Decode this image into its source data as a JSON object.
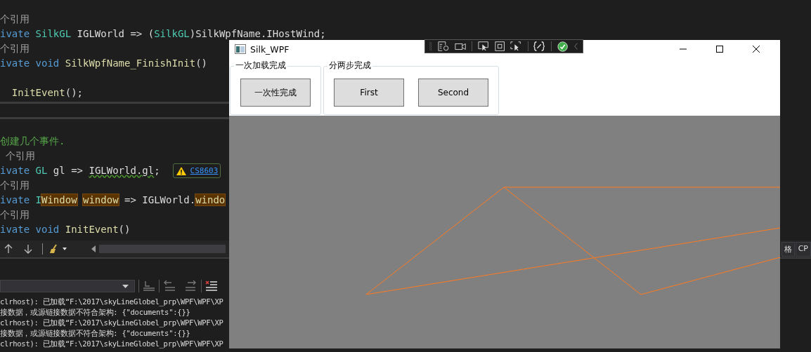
{
  "editor": {
    "top_pane": [
      {
        "kind": "code",
        "segments": [
          {
            "kind": "ref",
            "text": "个引用"
          }
        ]
      },
      {
        "kind": "code",
        "segments": [
          {
            "kind": "kw",
            "text": "ivate "
          },
          {
            "kind": "type",
            "text": "SilkGL"
          },
          {
            "kind": "plain",
            "text": " IGLWorld => ("
          },
          {
            "kind": "type",
            "text": "SilkGL"
          },
          {
            "kind": "plain",
            "text": ")SilkWpfName.IHostWind;"
          }
        ]
      },
      {
        "kind": "code",
        "segments": [
          {
            "kind": "ref",
            "text": "个引用"
          }
        ]
      },
      {
        "kind": "code",
        "segments": [
          {
            "kind": "kw",
            "text": "ivate void "
          },
          {
            "kind": "method",
            "text": "SilkWpfName_FinishInit"
          },
          {
            "kind": "plain",
            "text": "()"
          }
        ]
      },
      {
        "kind": "blank"
      },
      {
        "kind": "code",
        "segments": [
          {
            "kind": "method",
            "text": "  InitEvent"
          },
          {
            "kind": "plain",
            "text": "();"
          }
        ]
      }
    ],
    "bottom_pane": [
      {
        "kind": "blank"
      },
      {
        "kind": "code",
        "segments": [
          {
            "kind": "comment",
            "text": "创建几个事件."
          }
        ]
      },
      {
        "kind": "code",
        "segments": [
          {
            "kind": "ref",
            "text": " 个引用"
          }
        ]
      },
      {
        "kind": "code",
        "badge": "CS8603",
        "segments": [
          {
            "kind": "kw",
            "text": "ivate "
          },
          {
            "kind": "type",
            "text": "GL"
          },
          {
            "kind": "plain",
            "text": " gl => "
          },
          {
            "kind": "warn",
            "text": "IGLWorld.gl"
          },
          {
            "kind": "plain",
            "text": ";"
          }
        ]
      },
      {
        "kind": "code",
        "segments": [
          {
            "kind": "ref",
            "text": "个引用"
          }
        ]
      },
      {
        "kind": "code",
        "segments": [
          {
            "kind": "kw",
            "text": "ivate "
          },
          {
            "kind": "type",
            "text": "I"
          },
          {
            "kind": "hl",
            "text": "Window"
          },
          {
            "kind": "hl",
            "text": "window"
          },
          {
            "kind": "plain",
            "text": " => IGLWorld."
          },
          {
            "kind": "hl",
            "text": "windo"
          }
        ]
      },
      {
        "kind": "code",
        "segments": [
          {
            "kind": "ref",
            "text": "个引用"
          }
        ]
      },
      {
        "kind": "code",
        "segments": [
          {
            "kind": "kw",
            "text": "ivate void "
          },
          {
            "kind": "method",
            "text": "InitEvent"
          },
          {
            "kind": "plain",
            "text": "()"
          }
        ]
      }
    ]
  },
  "side_tabs": [
    "格",
    "CP"
  ],
  "output": {
    "lines": [
      "clrhost): 已加载“F:\\2017\\skyLineGlobel_prp\\WPF\\WPF\\XP",
      "接数据，或源链接数据不符合架构: {\"documents\":{}}",
      "clrhost): 已加载“F:\\2017\\skyLineGlobel_prp\\WPF\\WPF\\XP",
      "接数据，或源链接数据不符合架构: {\"documents\":{}}",
      "clrhost): 已加载“F:\\2017\\skyLineGlobel_prp\\WPF\\WPF\\XP"
    ]
  },
  "app_window": {
    "title": "Silk_WPF",
    "groups": [
      {
        "label": "一次加载完成",
        "buttons": [
          "一次性完成"
        ]
      },
      {
        "label": "分两步完成",
        "buttons": [
          "First",
          "Second"
        ]
      }
    ]
  }
}
